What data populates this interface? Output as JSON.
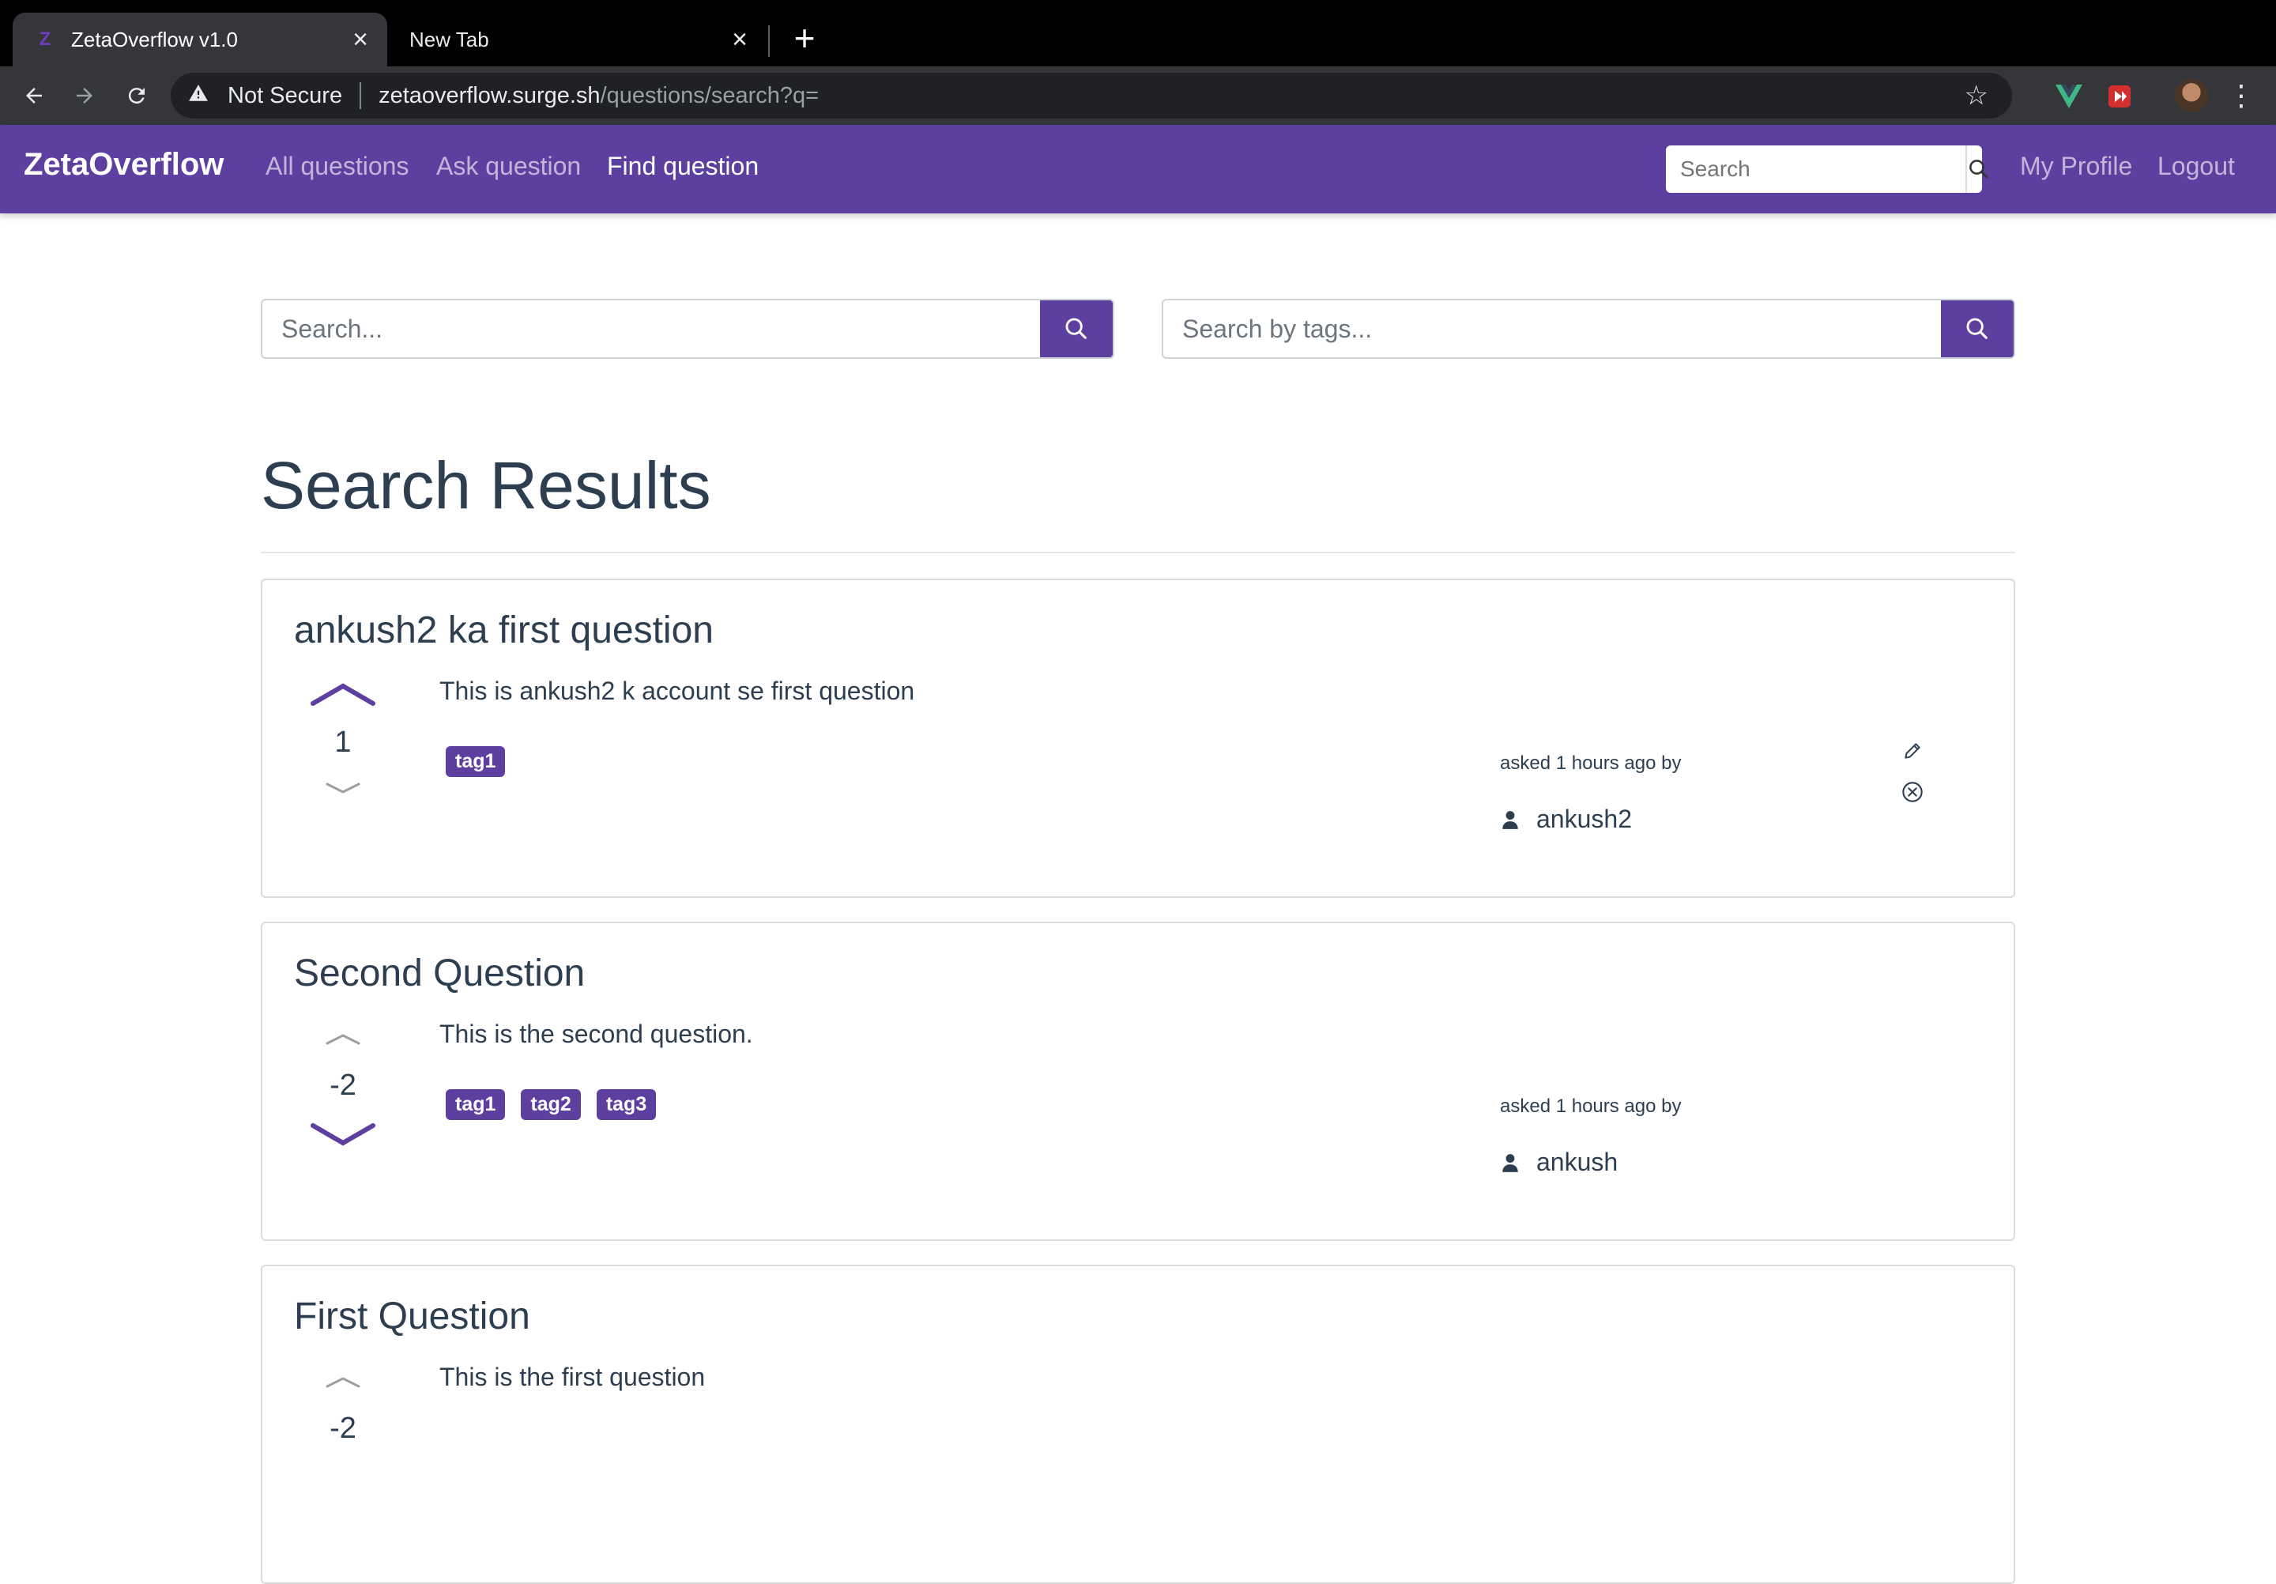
{
  "browser": {
    "tabs": [
      {
        "label": "ZetaOverflow v1.0",
        "favicon": "Z",
        "active": true
      },
      {
        "label": "New Tab",
        "active": false
      }
    ],
    "security_label": "Not Secure",
    "url_host": "zetaoverflow.surge.sh",
    "url_path": "/questions/search?q=",
    "icons": [
      "back-icon",
      "forward-icon",
      "reload-icon",
      "warning-icon",
      "star-icon",
      "vue-extension-icon",
      "red-extension-icon",
      "avatar",
      "menu-icon"
    ]
  },
  "navbar": {
    "brand": "ZetaOverflow",
    "links": [
      "All questions",
      "Ask question",
      "Find question"
    ],
    "active_link": "Find question",
    "search_placeholder": "Search",
    "profile": "My Profile",
    "logout": "Logout",
    "color": "#5d3f9f"
  },
  "search": {
    "text_placeholder": "Search...",
    "tags_placeholder": "Search by tags..."
  },
  "page": {
    "heading": "Search Results"
  },
  "questions": [
    {
      "title": "ankush2 ka first question",
      "body": "This is ankush2 k account se first question",
      "votes": "1",
      "upvoted": true,
      "downvoted": false,
      "tags": [
        "tag1"
      ],
      "asked": "asked 1 hours ago by",
      "author": "ankush2",
      "owner_actions": true
    },
    {
      "title": "Second Question",
      "body": "This is the second question.",
      "votes": "-2",
      "upvoted": false,
      "downvoted": true,
      "tags": [
        "tag1",
        "tag2",
        "tag3"
      ],
      "asked": "asked 1 hours ago by",
      "author": "ankush",
      "owner_actions": false
    },
    {
      "title": "First Question",
      "body": "This is the first question",
      "votes": "-2",
      "upvoted": false,
      "downvoted": false,
      "tags": [],
      "asked": "",
      "author": "",
      "owner_actions": false
    }
  ]
}
